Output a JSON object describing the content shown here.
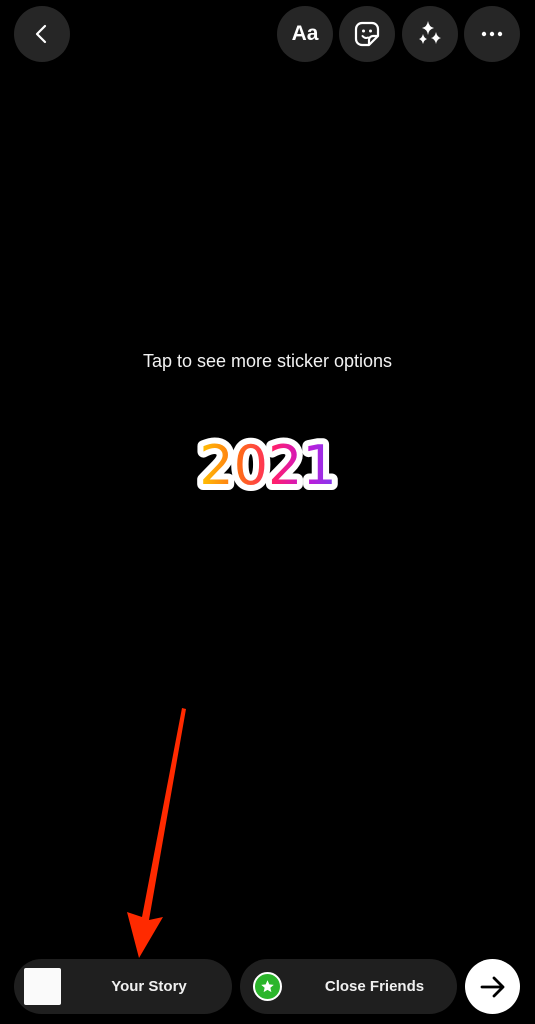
{
  "toolbar": {
    "back_icon": "chevron-left-icon",
    "text_label": "Aa",
    "sticker_icon": "sticker-icon",
    "effects_icon": "sparkles-icon",
    "more_icon": "more-horizontal-icon"
  },
  "canvas": {
    "hint": "Tap to see more sticker options",
    "sticker_text": "2021",
    "sticker_gradient": [
      "#ffc400",
      "#ff6a1a",
      "#ff1e6e",
      "#c418d6",
      "#7b3ff2"
    ]
  },
  "annotation": {
    "type": "arrow",
    "color": "#ff2a00",
    "points_to": "Your Story"
  },
  "share_bar": {
    "your_story_label": "Your Story",
    "close_friends_label": "Close Friends",
    "close_friends_color": "#2bb52b",
    "send_icon": "arrow-right-icon"
  }
}
